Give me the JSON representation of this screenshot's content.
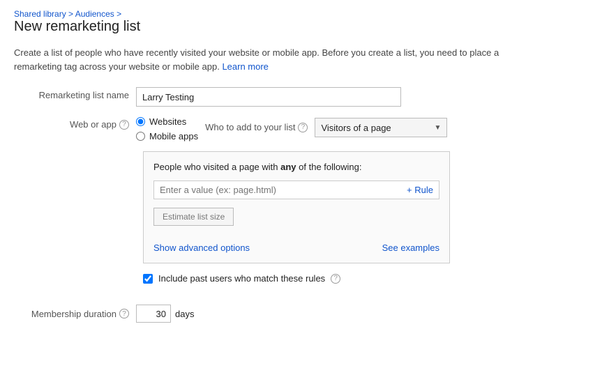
{
  "breadcrumb": {
    "shared_library": "Shared library",
    "audiences": "Audiences",
    "separator": " > "
  },
  "page": {
    "title": "New remarketing list",
    "description_part1": "Create a list of people who have recently visited your website or mobile app. Before you create a list, you need to place a remarketing tag across your website or mobile app.",
    "learn_more": "Learn more"
  },
  "form": {
    "remarketing_list_name_label": "Remarketing list name",
    "remarketing_list_name_value": "Larry Testing",
    "web_or_app_label": "Web or app",
    "websites_label": "Websites",
    "mobile_apps_label": "Mobile apps",
    "who_to_add_label": "Who to add to your list",
    "visitors_of_a_page": "Visitors of a page",
    "rules_title_part1": "People who visited a page with",
    "rules_title_any": "any",
    "rules_title_part2": "of the following:",
    "value_placeholder": "Enter a value (ex: page.html)",
    "add_rule": "+ Rule",
    "estimate_btn": "Estimate list size",
    "show_advanced": "Show advanced options",
    "see_examples": "See examples",
    "include_past_label": "Include past users who match these rules",
    "membership_duration_label": "Membership duration",
    "membership_duration_value": "30",
    "days_label": "days"
  },
  "colors": {
    "link": "#1155cc",
    "label": "#555555",
    "border": "#cccccc",
    "bg_box": "#fafafa"
  }
}
